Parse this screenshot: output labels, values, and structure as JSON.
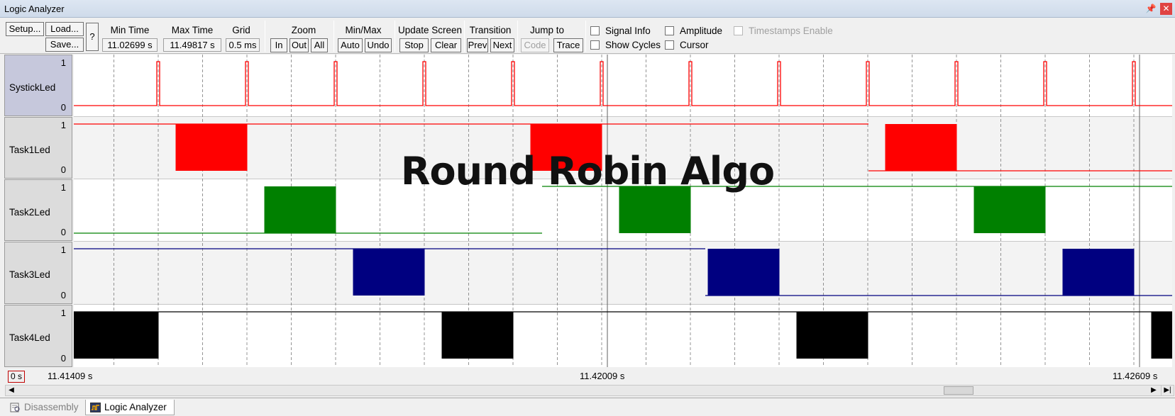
{
  "window": {
    "title": "Logic Analyzer",
    "pin_icon": "pin-icon",
    "close_icon": "close-icon"
  },
  "toolbar": {
    "setup": "Setup...",
    "load": "Load...",
    "save": "Save...",
    "help": "?",
    "min_time_label": "Min Time",
    "min_time": "11.02699 s",
    "max_time_label": "Max Time",
    "max_time": "11.49817 s",
    "grid_label": "Grid",
    "grid": "0.5 ms",
    "zoom_label": "Zoom",
    "zoom_in": "In",
    "zoom_out": "Out",
    "zoom_all": "All",
    "minmax_label": "Min/Max",
    "auto": "Auto",
    "undo": "Undo",
    "update_label": "Update Screen",
    "stop": "Stop",
    "clear": "Clear",
    "transition_label": "Transition",
    "prev": "Prev",
    "next": "Next",
    "jump_label": "Jump to",
    "code": "Code",
    "trace": "Trace",
    "signal_info": "Signal Info",
    "amplitude": "Amplitude",
    "timestamps": "Timestamps Enable",
    "show_cycles": "Show Cycles",
    "cursor": "Cursor"
  },
  "signals": [
    {
      "name": "SystickLed",
      "high": "1",
      "low": "0",
      "color": "#ff0000"
    },
    {
      "name": "Task1Led",
      "high": "1",
      "low": "0",
      "color": "#ff0000"
    },
    {
      "name": "Task2Led",
      "high": "1",
      "low": "0",
      "color": "#008000"
    },
    {
      "name": "Task3Led",
      "high": "1",
      "low": "0",
      "color": "#000080"
    },
    {
      "name": "Task4Led",
      "high": "1",
      "low": "0",
      "color": "#000000"
    }
  ],
  "waveforms": {
    "systick_pulses_at": [
      5,
      10,
      15,
      20,
      25,
      30,
      35,
      40,
      45,
      50,
      55,
      60
    ],
    "task_blocks": [
      {
        "signal": 1,
        "start": 6,
        "end": 10
      },
      {
        "signal": 2,
        "start": 11,
        "end": 15
      },
      {
        "signal": 3,
        "start": 16,
        "end": 20
      },
      {
        "signal": 4,
        "start": 21,
        "end": 25
      },
      {
        "signal": 1,
        "start": 26,
        "end": 30
      },
      {
        "signal": 2,
        "start": 31,
        "end": 35
      },
      {
        "signal": 3,
        "start": 36,
        "end": 40
      },
      {
        "signal": 4,
        "start": 41,
        "end": 45
      },
      {
        "signal": 1,
        "start": 46,
        "end": 50
      },
      {
        "signal": 2,
        "start": 51,
        "end": 55
      },
      {
        "signal": 3,
        "start": 56,
        "end": 60
      },
      {
        "signal": 4,
        "start": 61,
        "end": 64
      },
      {
        "signal": 4,
        "start": 0,
        "end": 5
      }
    ]
  },
  "overlay_text": "Round Robin Algo",
  "axis": {
    "zero": "0 s",
    "t1": "11.41409 s",
    "t2": "11.42009 s",
    "t3": "11.42609 s"
  },
  "tabs": [
    {
      "label": "Disassembly",
      "icon": "disassembly-icon"
    },
    {
      "label": "Logic Analyzer",
      "icon": "logic-analyzer-icon"
    }
  ]
}
